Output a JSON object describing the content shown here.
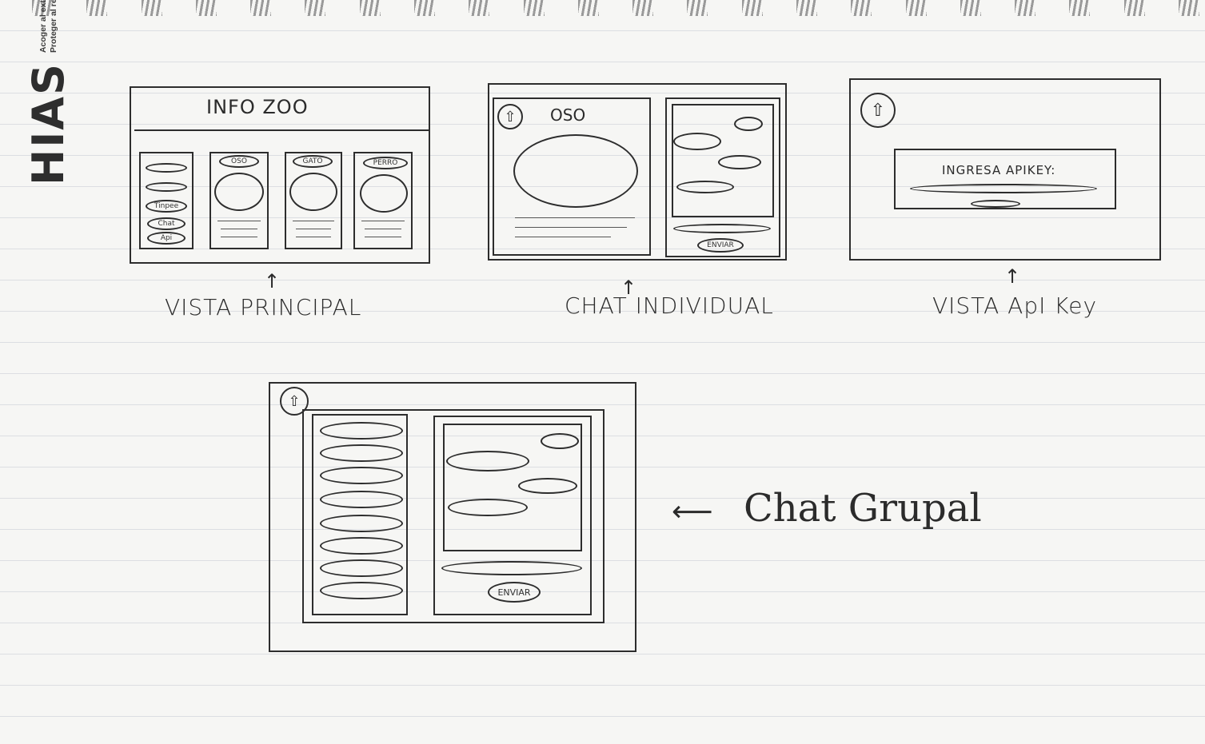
{
  "logo": {
    "mark": "HIAS",
    "tagline_line1": "Acoger al extranjero.",
    "tagline_line2": "Proteger al refugiado."
  },
  "sketches": {
    "vista_principal": {
      "caption": "VISTA PRINCIPAL",
      "header_title": "INFO ZOO",
      "menu_items": [
        "Tinpee",
        "Chat",
        "Api"
      ],
      "card_labels": [
        "OSO",
        "GATO",
        "PERRO"
      ]
    },
    "chat_individual": {
      "caption": "CHAT INDIVIDUAL",
      "animal_name": "OSO",
      "send_label": "ENVIAR"
    },
    "vista_apikey": {
      "caption": "VISTA ApI Key",
      "prompt_label": "INGRESA APIKEY:"
    },
    "chat_grupal": {
      "caption": "Chat Grupal",
      "send_label": "ENVIAR"
    }
  },
  "icons": {
    "arrow_up": "↑",
    "arrow_left": "⟵",
    "home": "⇧"
  }
}
